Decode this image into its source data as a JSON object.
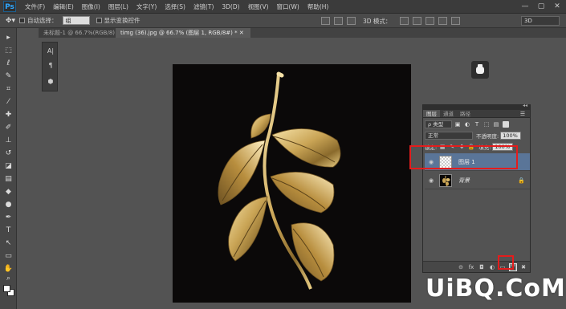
{
  "app": {
    "logo": "Ps"
  },
  "menu": [
    "文件(F)",
    "编辑(E)",
    "图像(I)",
    "图层(L)",
    "文字(Y)",
    "选择(S)",
    "滤镜(T)",
    "3D(D)",
    "视图(V)",
    "窗口(W)",
    "帮助(H)"
  ],
  "window_controls": [
    "—",
    "▢",
    "✕"
  ],
  "options_bar": {
    "auto_select_label": "自动选择：",
    "auto_select_value": "组",
    "show_transform_label": "显示变换控件",
    "mode_3d_label": "3D 模式：",
    "workspace": "3D"
  },
  "tabs": [
    {
      "label": "未标题-1 @ 66.7%(RGB/8) ✕"
    },
    {
      "label": "timg (36).jpg @ 66.7% (图层 1, RGB/8#) * ✕"
    }
  ],
  "layers_panel": {
    "tabs": [
      "图层",
      "通道",
      "路径"
    ],
    "filter_label": "ρ 类型",
    "blend_mode": "正常",
    "opacity_label": "不透明度:",
    "opacity_value": "100%",
    "lock_label": "锁定:",
    "fill_label": "填充:",
    "fill_value": "100%",
    "layers": [
      {
        "name": "图层 1",
        "selected": true,
        "thumbnail": "transparent"
      },
      {
        "name": "背景",
        "selected": false,
        "thumbnail": "image",
        "locked": true
      }
    ],
    "footer_icons": [
      "link-icon",
      "fx-icon",
      "mask-icon",
      "adjustment-icon",
      "group-icon",
      "new-layer-icon",
      "trash-icon"
    ]
  },
  "watermark": "UiBQ.CoM",
  "colors": {
    "accent": "#e41c1c",
    "selected_layer": "#5a7598",
    "canvas_bg": "#0b0909",
    "leaf_gold": "#c9a455"
  }
}
